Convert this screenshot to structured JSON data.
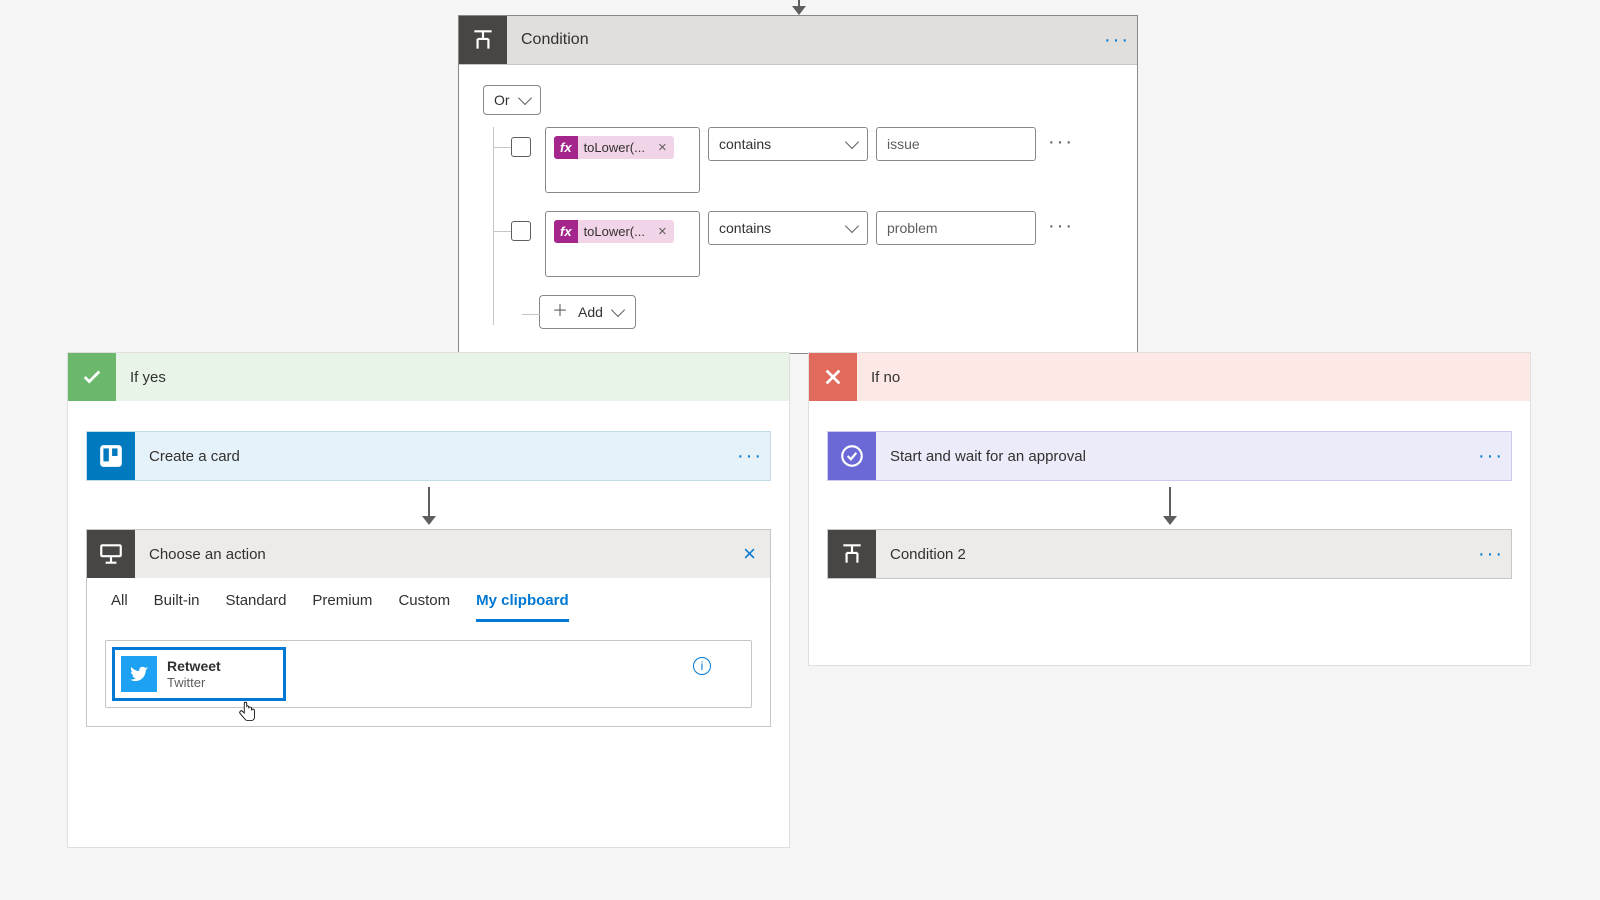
{
  "condition": {
    "title": "Condition",
    "operator": "Or",
    "rows": [
      {
        "fx": "fx",
        "token": "toLower(...",
        "op": "contains",
        "value": "issue"
      },
      {
        "fx": "fx",
        "token": "toLower(...",
        "op": "contains",
        "value": "problem"
      }
    ],
    "add_label": "Add"
  },
  "yes": {
    "title": "If yes",
    "action1": "Create a card",
    "picker": {
      "title": "Choose an action",
      "tabs": {
        "all": "All",
        "builtin": "Built-in",
        "standard": "Standard",
        "premium": "Premium",
        "custom": "Custom",
        "clipboard": "My clipboard"
      },
      "clip_item": {
        "title": "Retweet",
        "subtitle": "Twitter"
      }
    }
  },
  "no": {
    "title": "If no",
    "action1": "Start and wait for an approval",
    "action2": "Condition 2"
  }
}
